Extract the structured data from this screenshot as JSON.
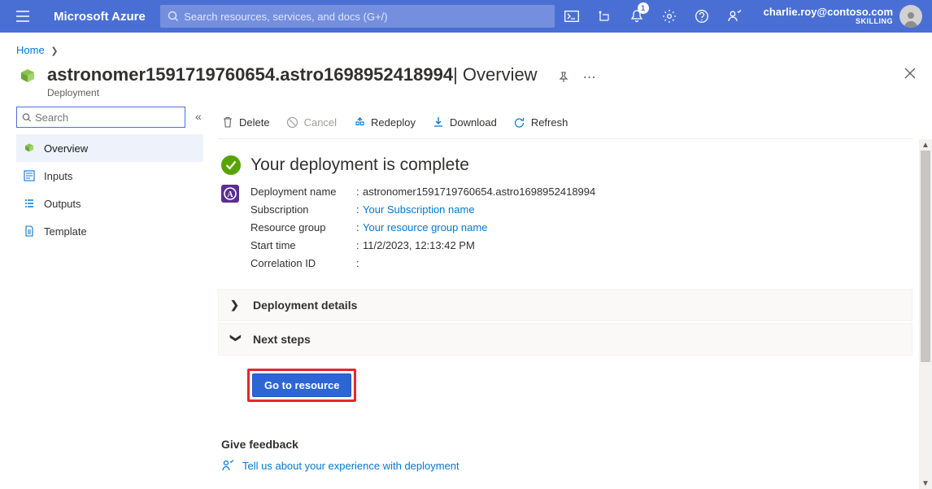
{
  "header": {
    "brand": "Microsoft Azure",
    "search_placeholder": "Search resources, services, and docs (G+/)",
    "notification_count": "1",
    "user_email": "charlie.roy@contoso.com",
    "user_tenant": "SKILLING"
  },
  "breadcrumb": {
    "items": [
      "Home"
    ]
  },
  "page": {
    "title_main": "astronomer1591719760654.astro1698952418994",
    "title_section": " | Overview",
    "subtitle": "Deployment"
  },
  "sidebar": {
    "search_placeholder": "Search",
    "items": [
      {
        "label": "Overview",
        "icon": "cube-icon",
        "active": true
      },
      {
        "label": "Inputs",
        "icon": "form-icon",
        "active": false
      },
      {
        "label": "Outputs",
        "icon": "list-icon",
        "active": false
      },
      {
        "label": "Template",
        "icon": "document-icon",
        "active": false
      }
    ]
  },
  "toolbar": {
    "delete_label": "Delete",
    "cancel_label": "Cancel",
    "redeploy_label": "Redeploy",
    "download_label": "Download",
    "refresh_label": "Refresh"
  },
  "status": {
    "heading": "Your deployment is complete",
    "product_badge": "A"
  },
  "details": {
    "deployment_name_label": "Deployment name",
    "deployment_name_value": "astronomer1591719760654.astro1698952418994",
    "subscription_label": "Subscription",
    "subscription_value": "Your Subscription name",
    "resource_group_label": "Resource group",
    "resource_group_value": "Your resource group name",
    "start_time_label": "Start time",
    "start_time_value": "11/2/2023, 12:13:42 PM",
    "correlation_id_label": "Correlation ID",
    "correlation_id_value": ""
  },
  "sections": {
    "deployment_details": "Deployment details",
    "next_steps": "Next steps"
  },
  "actions": {
    "go_to_resource": "Go to resource"
  },
  "feedback": {
    "title": "Give feedback",
    "link_text": "Tell us about your experience with deployment"
  }
}
